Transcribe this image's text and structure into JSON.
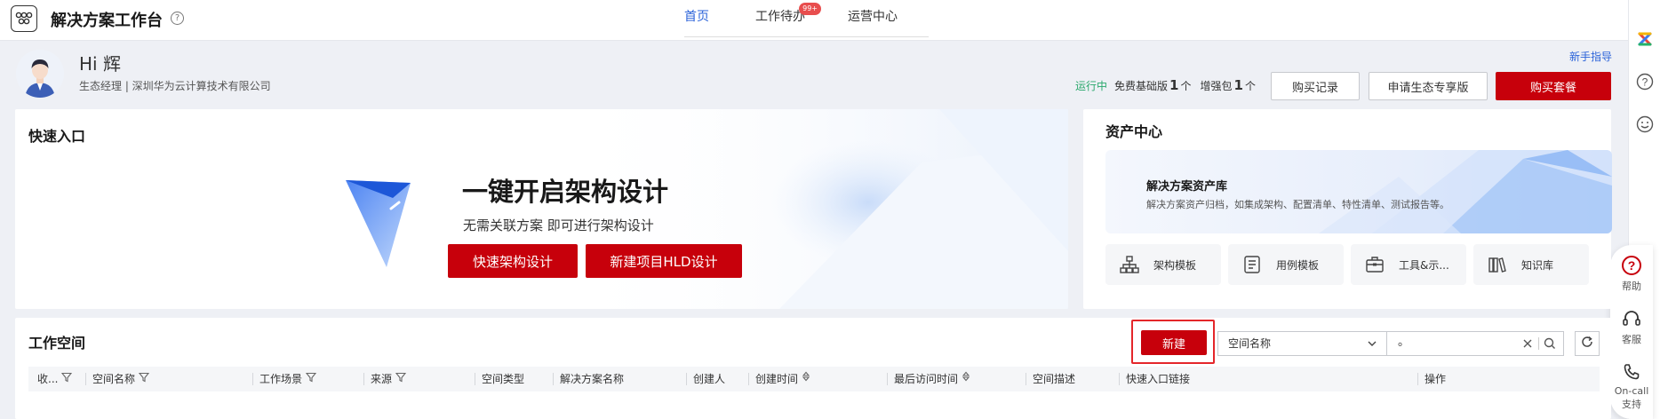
{
  "header": {
    "app_title": "解决方案工作台",
    "nav": [
      {
        "label": "首页",
        "active": true
      },
      {
        "label": "工作待办",
        "badge": "99+"
      },
      {
        "label": "运营中心"
      }
    ]
  },
  "user": {
    "greeting": "Hi 辉",
    "role": "生态经理 | 深圳华为云计算技术有限公司",
    "guide_link": "新手指导",
    "status": "运行中",
    "free_label": "免费基础版",
    "free_count": "1",
    "unit1": "个",
    "boost_label": "增强包",
    "boost_count": "1",
    "unit2": "个",
    "buttons": {
      "purchase_records": "购买记录",
      "apply_edition": "申请生态专享版",
      "buy_package": "购买套餐"
    }
  },
  "quick": {
    "title": "快速入口",
    "hero_title": "一键开启架构设计",
    "hero_sub": "无需关联方案 即可进行架构设计",
    "btn_quick": "快速架构设计",
    "btn_new_hld": "新建项目HLD设计"
  },
  "assets": {
    "title": "资产中心",
    "banner_title": "解决方案资产库",
    "banner_desc": "解决方案资产归档，如集成架构、配置清单、特性清单、测试报告等。",
    "tiles": [
      {
        "label": "架构模板",
        "icon": "architecture-icon"
      },
      {
        "label": "用例模板",
        "icon": "document-list-icon"
      },
      {
        "label": "工具&示...",
        "icon": "toolbox-icon"
      },
      {
        "label": "知识库",
        "icon": "books-icon"
      }
    ]
  },
  "workspace": {
    "title": "工作空间",
    "new_button": "新建",
    "select_value": "空间名称",
    "search_value": "。",
    "columns": [
      {
        "label": "收...",
        "filter": true
      },
      {
        "label": "空间名称",
        "filter": true
      },
      {
        "label": "工作场景",
        "filter": true
      },
      {
        "label": "来源",
        "filter": true
      },
      {
        "label": "空间类型"
      },
      {
        "label": "解决方案名称"
      },
      {
        "label": "创建人"
      },
      {
        "label": "创建时间",
        "sort": true
      },
      {
        "label": "最后访问时间",
        "sort": true
      },
      {
        "label": "空间描述"
      },
      {
        "label": "快速入口链接"
      },
      {
        "label": "操作"
      }
    ]
  },
  "float_help": {
    "help": "帮助",
    "service": "客服",
    "oncall_line1": "On-call",
    "oncall_line2": "支持"
  },
  "colors": {
    "brand_red": "#c7000b",
    "link_blue": "#2b63d9",
    "status_green": "#2aa86c"
  }
}
